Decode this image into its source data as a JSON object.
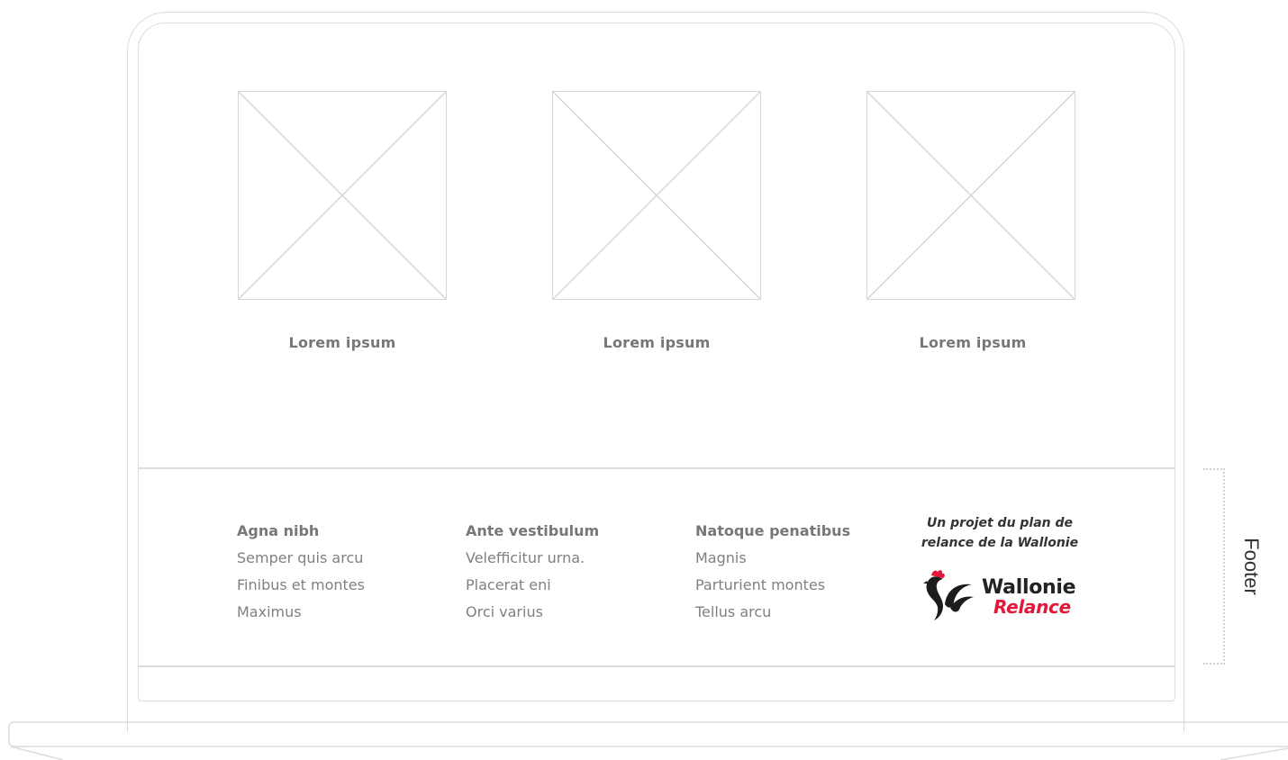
{
  "cards": [
    {
      "title": "Lorem ipsum",
      "image_icon": "image-placeholder-icon"
    },
    {
      "title": "Lorem ipsum",
      "image_icon": "image-placeholder-icon"
    },
    {
      "title": "Lorem ipsum",
      "image_icon": "image-placeholder-icon"
    }
  ],
  "footer": {
    "columns": [
      {
        "heading": "Agna nibh",
        "items": [
          "Semper quis arcu",
          "Finibus et montes",
          "Maximus"
        ]
      },
      {
        "heading": "Ante vestibulum",
        "items": [
          "Velefficitur urna.",
          "Placerat eni",
          "Orci varius"
        ]
      },
      {
        "heading": "Natoque penatibus",
        "items": [
          "Magnis",
          "Parturient montes",
          "Tellus arcu"
        ]
      }
    ],
    "promo": {
      "line1": "Un projet du plan de",
      "line2": "relance de la Wallonie"
    },
    "brand": {
      "name_primary": "Wallonie",
      "name_secondary": "Relance",
      "logo_icon": "rooster-icon",
      "accent_color": "#e3173a"
    }
  },
  "annotation": {
    "label": "Footer"
  }
}
